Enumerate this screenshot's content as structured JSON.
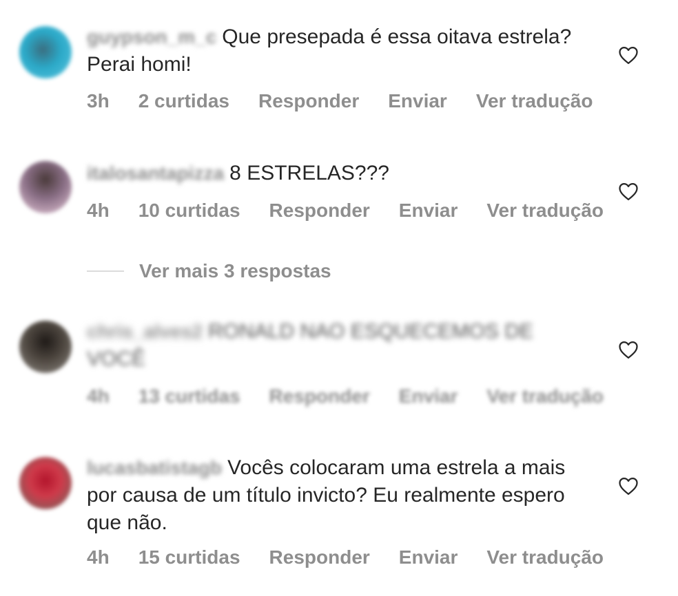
{
  "comments": [
    {
      "username": "guypson_m_c",
      "text": "Que presepada é essa oitava estrela? Perai homi!",
      "time": "3h",
      "likes": "2 curtidas",
      "reply": "Responder",
      "send": "Enviar",
      "translate": "Ver tradução"
    },
    {
      "username": "italosantapizza",
      "text": "8 ESTRELAS???",
      "time": "4h",
      "likes": "10 curtidas",
      "reply": "Responder",
      "send": "Enviar",
      "translate": "Ver tradução"
    },
    {
      "username": "chris_alves2",
      "text": "RONALD NAO ESQUECEMOS DE VOCÊ",
      "time": "4h",
      "likes": "13 curtidas",
      "reply": "Responder",
      "send": "Enviar",
      "translate": "Ver tradução"
    },
    {
      "username": "lucasbatistagb",
      "text": "Vocês colocaram uma estrela a mais por causa de um título invicto? Eu realmente espero que não.",
      "time": "4h",
      "likes": "15 curtidas",
      "reply": "Responder",
      "send": "Enviar",
      "translate": "Ver tradução"
    }
  ],
  "more_replies": "Ver mais 3 respostas",
  "icons": {
    "like": "heart-outline-icon"
  }
}
